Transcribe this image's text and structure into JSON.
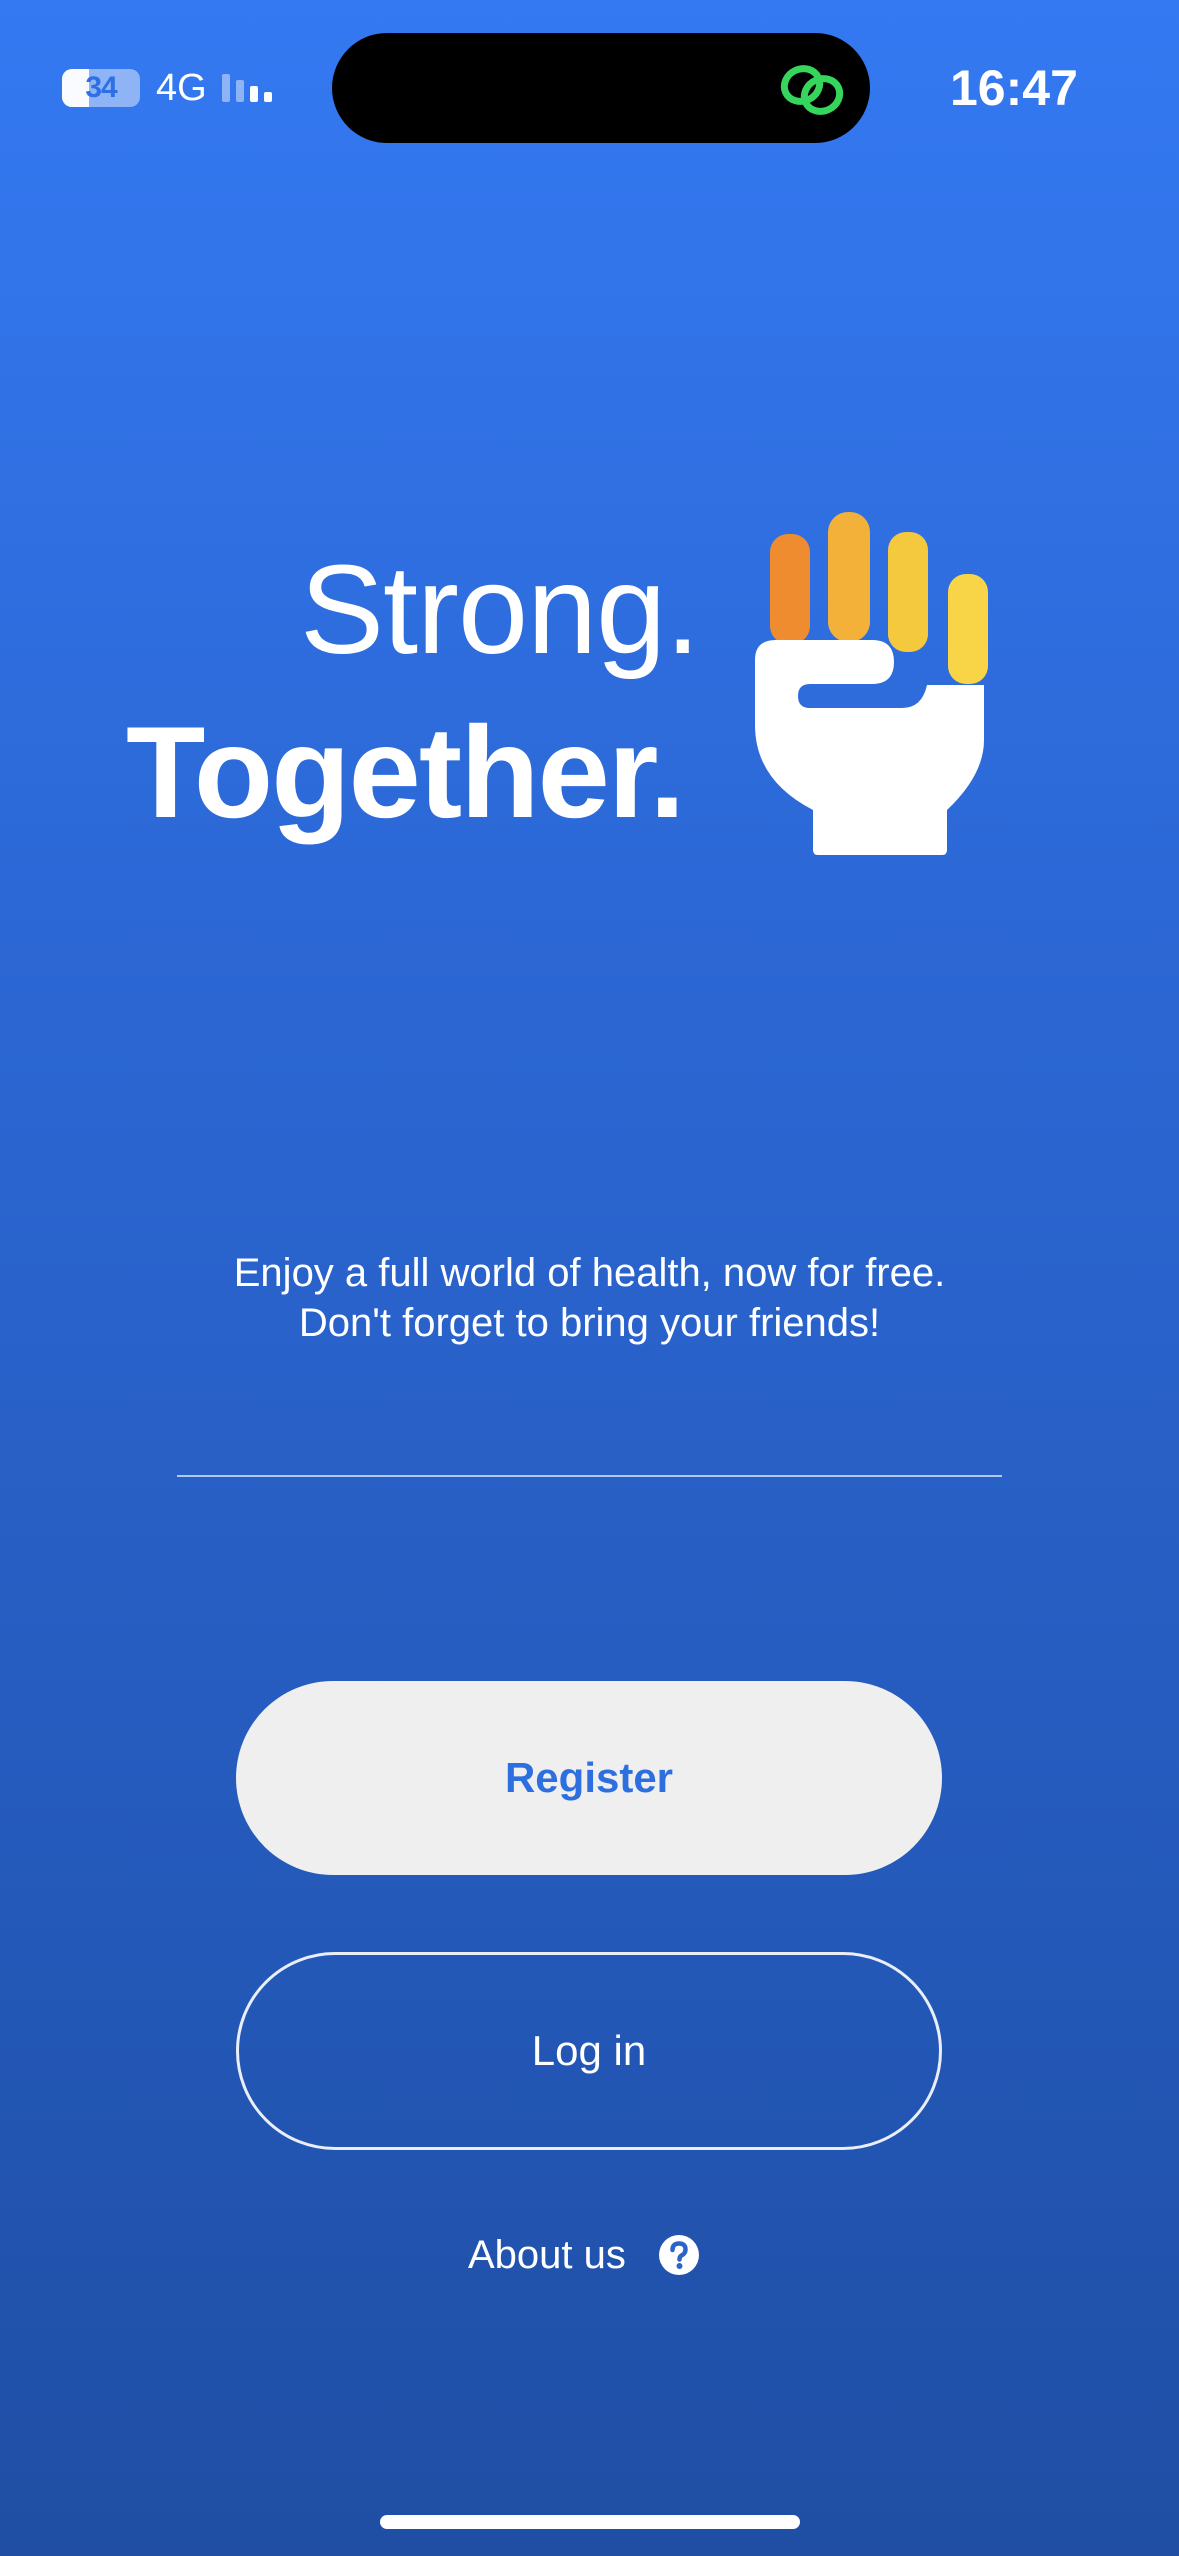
{
  "status_bar": {
    "battery": "34",
    "network": "4G",
    "time": "16:47"
  },
  "hero": {
    "line1": "Strong.",
    "line2": "Together."
  },
  "tagline": {
    "line1": "Enjoy a full world of health, now for free.",
    "line2": "Don't forget to bring your friends!"
  },
  "actions": {
    "register_label": "Register",
    "login_label": "Log in",
    "about_label": "About us"
  },
  "colors": {
    "background_top": "#3479f2",
    "background_bottom": "#1f4ea4",
    "register_bg": "#efefef",
    "register_text": "#2e6fe0",
    "finger_colors": [
      "#ef8c30",
      "#f4b13a",
      "#f5c93e",
      "#f7d546"
    ],
    "link_icon": "#35d65b"
  },
  "icons": {
    "battery": "battery-icon",
    "signal": "cellular-signal-icon",
    "island_activity": "link-icon",
    "logo": "fist-logo",
    "about": "help-circle-icon"
  }
}
